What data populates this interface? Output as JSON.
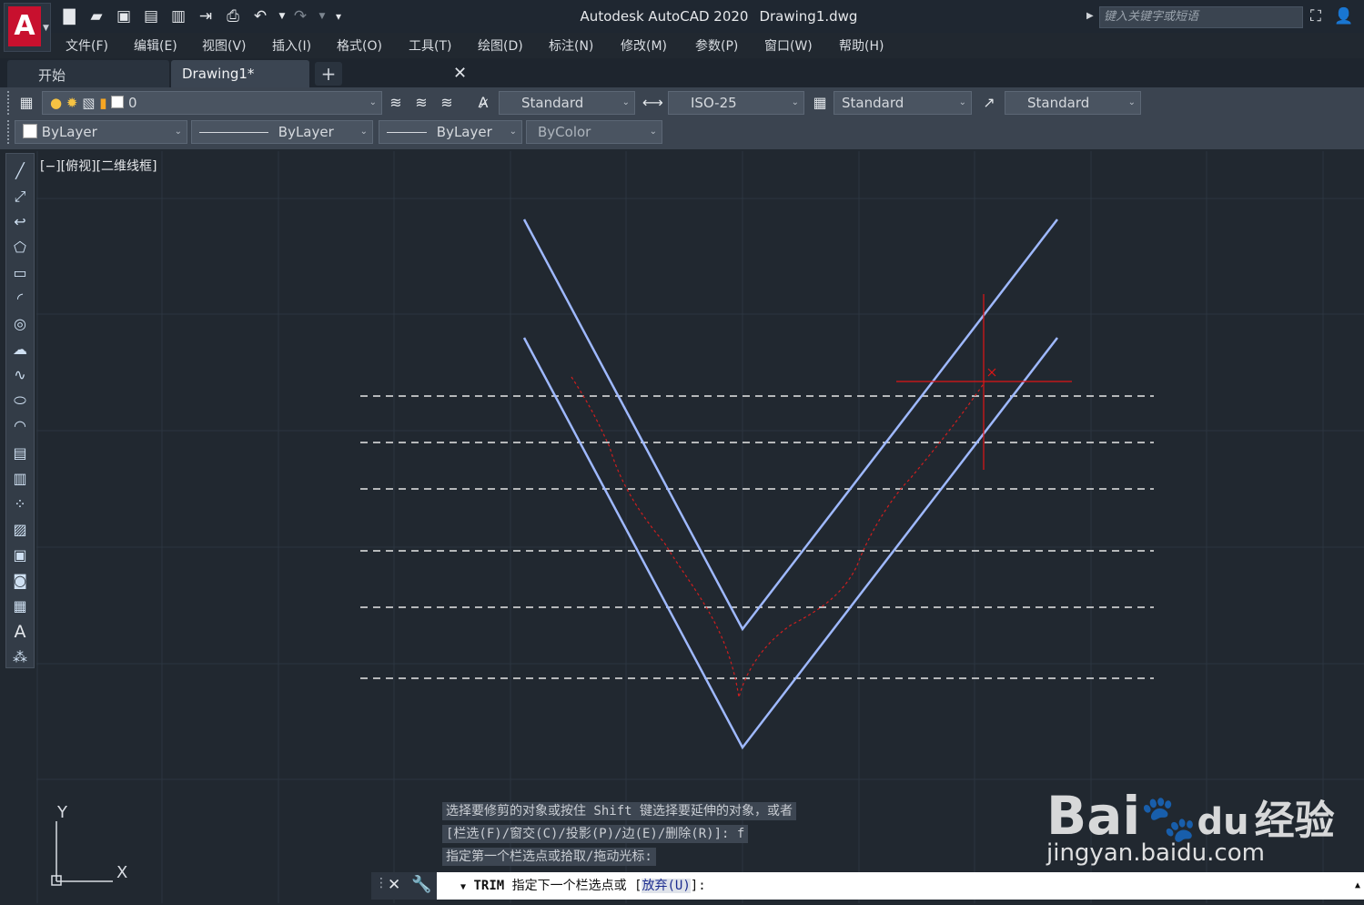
{
  "app": {
    "logo_letter": "A",
    "title": "Autodesk AutoCAD 2020",
    "filename": "Drawing1.dwg",
    "search_placeholder": "键入关键字或短语"
  },
  "menu": [
    "文件(F)",
    "编辑(E)",
    "视图(V)",
    "插入(I)",
    "格式(O)",
    "工具(T)",
    "绘图(D)",
    "标注(N)",
    "修改(M)",
    "参数(P)",
    "窗口(W)",
    "帮助(H)"
  ],
  "tabs": {
    "start": "开始",
    "drawing": "Drawing1*",
    "close": "✕",
    "add": "+"
  },
  "toolbar": {
    "layer_value": "0",
    "text_style": "Standard",
    "dim_style": "ISO-25",
    "table_style": "Standard",
    "mleader_style": "Standard",
    "color": "ByLayer",
    "linetype": "ByLayer",
    "lineweight": "ByLayer",
    "plotstyle": "ByColor"
  },
  "viewport": {
    "label": "[−][俯视][二维线框]",
    "ucs_x": "X",
    "ucs_y": "Y"
  },
  "command": {
    "history": [
      "选择要修剪的对象或按住 Shift 键选择要延伸的对象，或者",
      "[栏选(F)/窗交(C)/投影(P)/边(E)/删除(R)]: f",
      "指定第一个栏选点或拾取/拖动光标:"
    ],
    "name": "TRIM",
    "prompt": "指定下一个栏选点或 [",
    "option": "放弃(U)",
    "prompt_end": "]:"
  },
  "watermark": {
    "brand": "Bai",
    "brand2": "du",
    "site_cn": "经验",
    "url": "jingyan.baidu.com"
  },
  "colors": {
    "background": "#212830",
    "geometry_line": "#9fb9ff",
    "fence_line": "#d01e1e",
    "crosshair": "#e01515",
    "dashed_line": "#e8e8e8"
  }
}
